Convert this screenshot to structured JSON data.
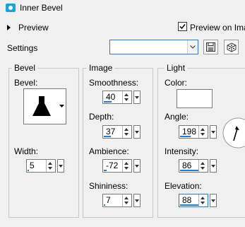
{
  "title": "Inner Bevel",
  "preview": {
    "label": "Preview",
    "preview_on_image_label": "Preview on Ima",
    "preview_on_image_checked": true
  },
  "settings": {
    "label": "Settings",
    "combo_value": ""
  },
  "bevel": {
    "group_title": "Bevel",
    "bevel_label": "Bevel:",
    "width_label": "Width:",
    "width_value": "5",
    "width_level": 0.08
  },
  "image": {
    "group_title": "Image",
    "smoothness_label": "Smoothness:",
    "smoothness_value": "40",
    "smoothness_level": 0.4,
    "depth_label": "Depth:",
    "depth_value": "37",
    "depth_level": 0.37,
    "ambience_label": "Ambience:",
    "ambience_value": "-72",
    "ambience_level": 0.14,
    "shininess_label": "Shininess:",
    "shininess_value": "7",
    "shininess_level": 0.07
  },
  "light": {
    "group_title": "Light",
    "color_label": "Color:",
    "color_value": "#ffffff",
    "angle_label": "Angle:",
    "angle_value": "198",
    "angle_level": 0.55,
    "intensity_label": "Intensity:",
    "intensity_value": "86",
    "intensity_level": 0.86,
    "elevation_label": "Elevation:",
    "elevation_value": "88",
    "elevation_level": 0.98
  },
  "colors": {
    "accent": "#1e7bd6",
    "title_icon": "#1aa3d9"
  }
}
